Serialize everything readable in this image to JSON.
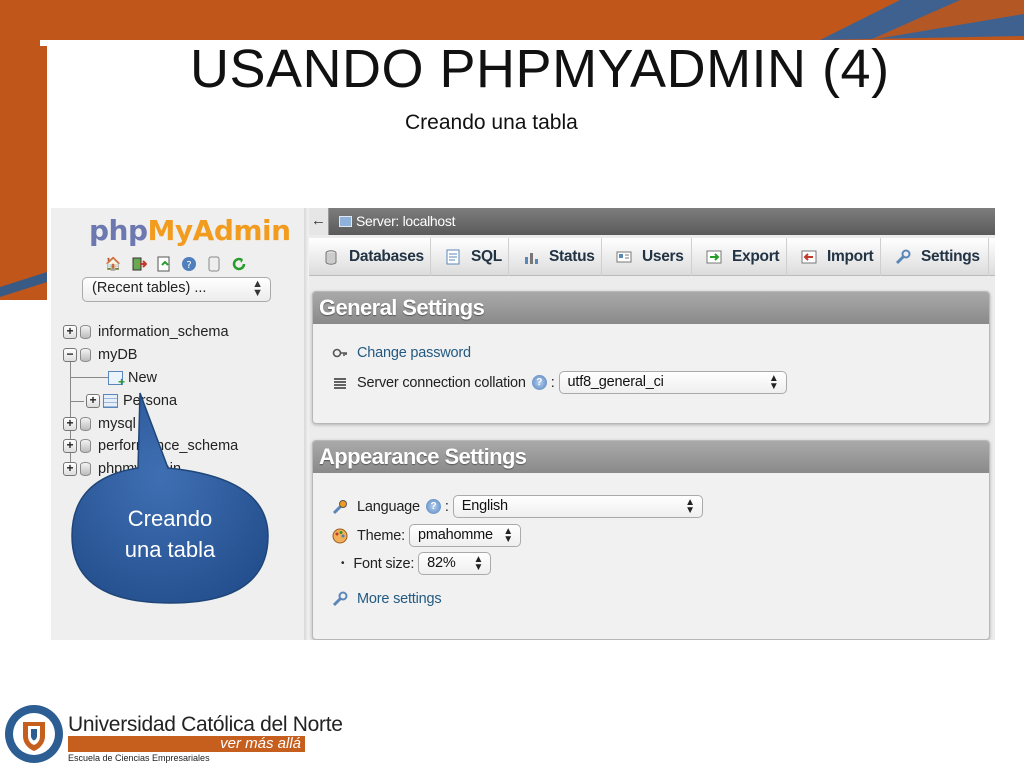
{
  "slide": {
    "title": "USANDO PHPMYADMIN (4)",
    "subtitle": "Creando una tabla"
  },
  "callout": {
    "line1": "Creando",
    "line2": "una tabla"
  },
  "nav": {
    "logo_php": "php",
    "logo_my": "My",
    "logo_admin": "Admin",
    "recent_select": "(Recent tables) ...",
    "tree": [
      {
        "label": "information_schema"
      },
      {
        "label": "myDB"
      },
      {
        "label": "New"
      },
      {
        "label": "Persona"
      },
      {
        "label": "mysql"
      },
      {
        "label": "performance_schema"
      },
      {
        "label": "phpmyadmin"
      }
    ]
  },
  "main": {
    "server_label": "Server: localhost",
    "back_arrow": "←",
    "tabs": [
      {
        "label": "Databases",
        "icon": "database-icon"
      },
      {
        "label": "SQL",
        "icon": "sql-icon"
      },
      {
        "label": "Status",
        "icon": "status-icon"
      },
      {
        "label": "Users",
        "icon": "users-icon"
      },
      {
        "label": "Export",
        "icon": "export-icon"
      },
      {
        "label": "Import",
        "icon": "import-icon"
      },
      {
        "label": "Settings",
        "icon": "wrench-icon"
      }
    ],
    "general": {
      "heading": "General Settings",
      "change_password": "Change password",
      "collation_label": "Server connection collation",
      "collation_value": "utf8_general_ci"
    },
    "appearance": {
      "heading": "Appearance Settings",
      "language_label": "Language",
      "language_value": "English",
      "theme_label": "Theme:",
      "theme_value": "pmahomme",
      "font_label": "Font size:",
      "font_value": "82%",
      "more_settings": "More settings"
    }
  },
  "footer": {
    "university": "Universidad Católica del Norte",
    "motto": "ver más allá",
    "school": "Escuela de Ciencias Empresariales"
  },
  "colors": {
    "slide_orange": "#c0561a",
    "slide_blue": "#3a5a86",
    "callout_blue": "#2f5b9c",
    "motto_orange": "#c65f1e"
  }
}
